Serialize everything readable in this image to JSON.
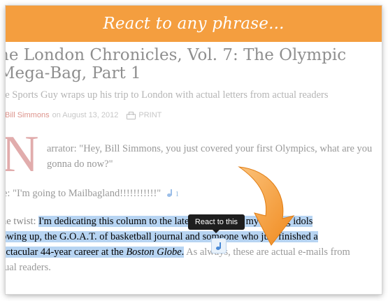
{
  "banner": {
    "title": "React to any phrase..."
  },
  "article": {
    "title_line1": "he London Chronicles, Vol. 7: The Olympic",
    "title_line2": "Mega-Bag, Part 1",
    "subtitle": "he Sports Guy wraps up his trip to London with actual letters from actual readers",
    "author": "Bill Simmons",
    "date_text": "on August 13, 2012",
    "print_label": "PRINT",
    "dropcap": "N",
    "para1_line1": "arrator: \"Hey, Bill Simmons, you just covered your first Olympics, what are you",
    "para1_line2": "gonna do now?\"",
    "para2": "e: \"I'm going to Mailbagland!!!!!!!!!!!\"",
    "para2_react_count": "1",
    "sel_line1_prefix": "he twist: ",
    "sel_line1_highlight": "I'm dedicating this column to the late Ryan, one of my writing idols",
    "sel_line2_highlight": "owing up, the G.O.A.T. of basketball journal    and someone who just finished a",
    "sel_line3_highlight_a": "ectacular 44-year career at the ",
    "sel_line3_highlight_italic": "Boston Globe",
    "sel_line3_highlight_b": ".",
    "sel_line3_tail": " As always, these are actual e-mails from",
    "sel_line4": "tual readers."
  },
  "tooltip": {
    "label": "React to this"
  },
  "colors": {
    "banner": "#f49e3f",
    "highlight": "#b7d4f2",
    "tooltip_bg": "#1e1e1e",
    "author": "#c0392b"
  }
}
